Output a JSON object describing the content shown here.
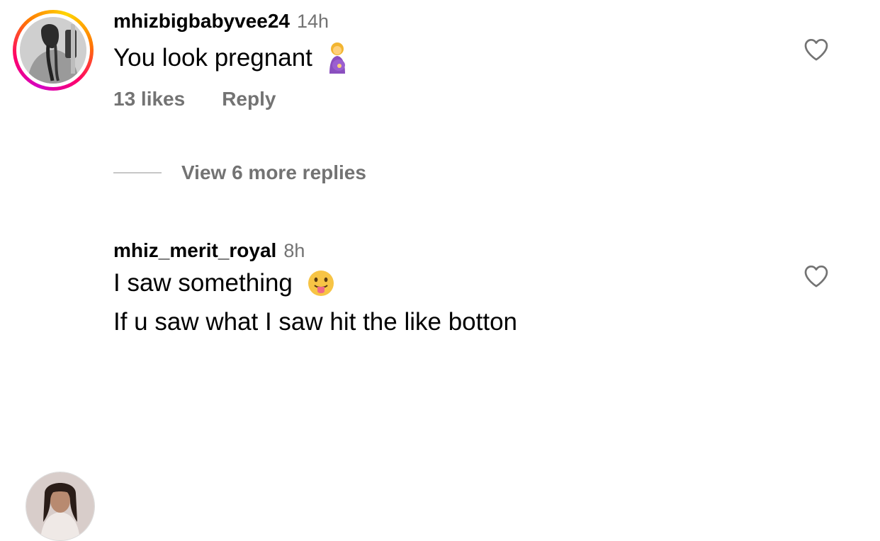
{
  "comments": [
    {
      "username": "mhizbigbabyvee24",
      "time": "14h",
      "text": "You look pregnant",
      "emoji": "pregnant-woman-emoji",
      "likes": "13 likes",
      "reply": "Reply"
    },
    {
      "username": "mhiz_merit_royal",
      "time": "8h",
      "text_line1": "I saw something",
      "emoji": "tongue-out-emoji",
      "text_line2": "If u saw what I saw hit the like botton"
    }
  ],
  "view_replies": "View 6 more replies",
  "colors": {
    "secondary_text": "#737373",
    "story_ring": [
      "#d300c5",
      "#ff0069",
      "#ff7a00",
      "#ffd600"
    ]
  }
}
